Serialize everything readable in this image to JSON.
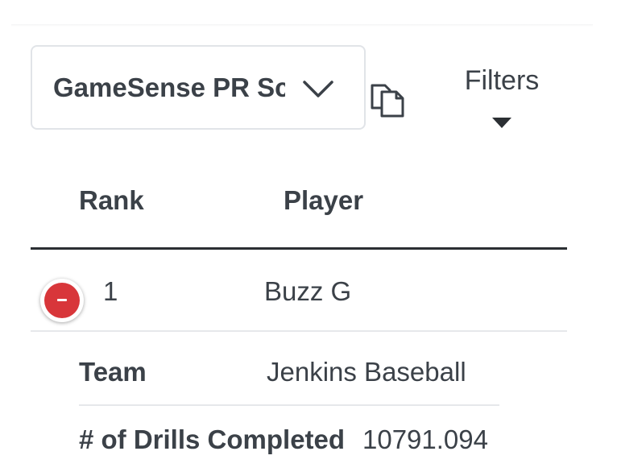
{
  "leaderboard_select": {
    "selected": "GameSense PR Score"
  },
  "filters": {
    "label": "Filters"
  },
  "table": {
    "columns": [
      "Rank",
      "Player"
    ],
    "rows": [
      {
        "rank": "1",
        "player": "Buzz G",
        "details": [
          {
            "label": "Team",
            "value": "Jenkins Baseball"
          },
          {
            "label": "# of Drills Completed",
            "value": "10791.094"
          }
        ]
      }
    ]
  },
  "colors": {
    "text": "#3b4148",
    "collapse_button": "#d8363a",
    "border": "#e1e4e8"
  },
  "icons": {
    "dropdown": "chevron-down-icon",
    "copy": "copy-icon",
    "filters": "caret-down-icon",
    "collapse": "minus-circle-icon"
  }
}
